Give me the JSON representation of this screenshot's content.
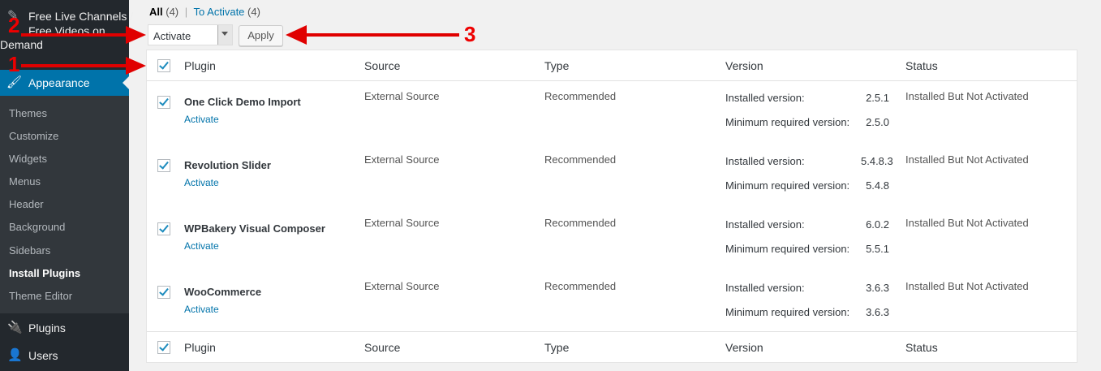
{
  "sidebar": {
    "site_label_line1": "Free Live Channels /",
    "site_label_line2": "Free Videos on",
    "site_label_line3": "Demand",
    "appearance_label": "Appearance",
    "submenu": [
      "Themes",
      "Customize",
      "Widgets",
      "Menus",
      "Header",
      "Background",
      "Sidebars",
      "Install Plugins",
      "Theme Editor"
    ],
    "current_submenu": "Install Plugins",
    "plugins_label": "Plugins",
    "users_label": "Users"
  },
  "filters": {
    "all_label": "All",
    "all_count": "(4)",
    "separator": "|",
    "to_activate_label": "To Activate",
    "to_activate_count": "(4)"
  },
  "bulk": {
    "selected": "Activate",
    "apply_label": "Apply"
  },
  "table": {
    "headers": {
      "plugin": "Plugin",
      "source": "Source",
      "type": "Type",
      "version": "Version",
      "status": "Status"
    },
    "rows": [
      {
        "name": "One Click Demo Import",
        "action": "Activate",
        "source": "External Source",
        "type": "Recommended",
        "installed_label": "Installed version:",
        "installed": "2.5.1",
        "min_label": "Minimum required version:",
        "min": "2.5.0",
        "status": "Installed But Not Activated"
      },
      {
        "name": "Revolution Slider",
        "action": "Activate",
        "source": "External Source",
        "type": "Recommended",
        "installed_label": "Installed version:",
        "installed": "5.4.8.3",
        "min_label": "Minimum required version:",
        "min": "5.4.8",
        "status": "Installed But Not Activated"
      },
      {
        "name": "WPBakery Visual Composer",
        "action": "Activate",
        "source": "External Source",
        "type": "Recommended",
        "installed_label": "Installed version:",
        "installed": "6.0.2",
        "min_label": "Minimum required version:",
        "min": "5.5.1",
        "status": "Installed But Not Activated"
      },
      {
        "name": "WooCommerce",
        "action": "Activate",
        "source": "External Source",
        "type": "Recommended",
        "installed_label": "Installed version:",
        "installed": "3.6.3",
        "min_label": "Minimum required version:",
        "min": "3.6.3",
        "status": "Installed But Not Activated"
      }
    ]
  },
  "annotations": {
    "one": "1",
    "two": "2",
    "three": "3",
    "color": "#e00000"
  },
  "colors": {
    "sidebar": "#23282d",
    "submenu": "#32373c",
    "accent": "#0073aa",
    "link": "#0073aa"
  }
}
